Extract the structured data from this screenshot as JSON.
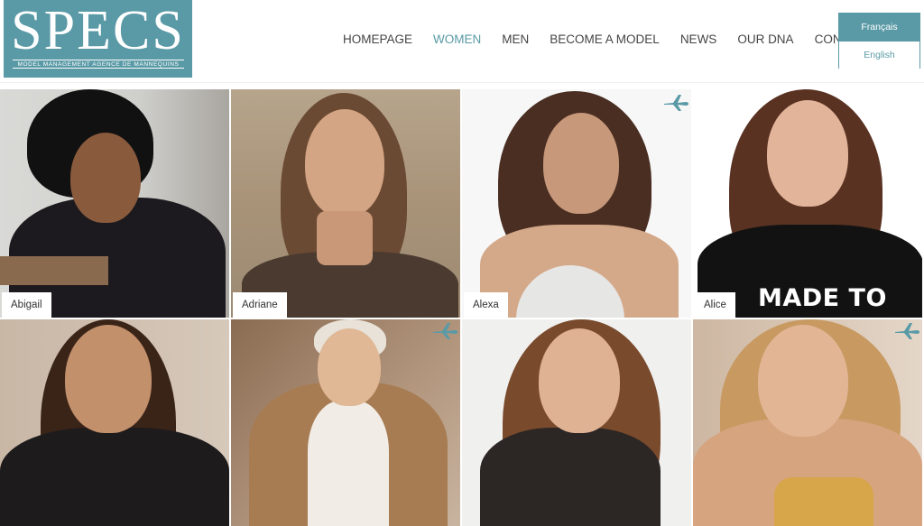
{
  "brand": {
    "name": "SPECS",
    "tagline": "MODEL MANAGEMENT AGENCE DE MANNEQUINS",
    "color": "#5a9aa6"
  },
  "nav": {
    "items": [
      {
        "label": "HOMEPAGE",
        "active": false
      },
      {
        "label": "WOMEN",
        "active": true
      },
      {
        "label": "MEN",
        "active": false
      },
      {
        "label": "BECOME A MODEL",
        "active": false
      },
      {
        "label": "NEWS",
        "active": false
      },
      {
        "label": "OUR DNA",
        "active": false
      },
      {
        "label": "CONTACT",
        "active": false
      }
    ]
  },
  "language": {
    "french": "Français",
    "english": "English"
  },
  "models": [
    {
      "name": "Abigail",
      "travel_icon": false
    },
    {
      "name": "Adriane",
      "travel_icon": false
    },
    {
      "name": "Alexa",
      "travel_icon": true
    },
    {
      "name": "Alice",
      "travel_icon": false,
      "shirt_text": "MADE TO"
    },
    {
      "name": "",
      "travel_icon": false
    },
    {
      "name": "",
      "travel_icon": true
    },
    {
      "name": "",
      "travel_icon": false
    },
    {
      "name": "",
      "travel_icon": true
    }
  ],
  "icons": {
    "travel": "airplane-icon"
  }
}
